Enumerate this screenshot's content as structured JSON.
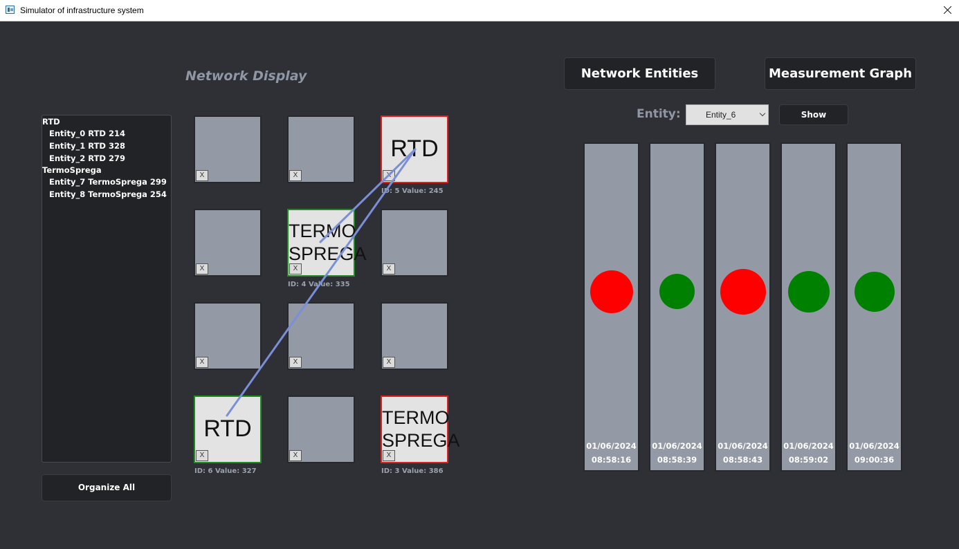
{
  "window": {
    "title": "Simulator of infrastructure system"
  },
  "heading": "Network Display",
  "tree": [
    {
      "group": "RTD",
      "items": [
        "Entity_0 RTD 214",
        "Entity_1 RTD 328",
        "Entity_2 RTD 279"
      ]
    },
    {
      "group": "TermoSprega",
      "items": [
        "Entity_7 TermoSprega 299",
        "Entity_8 TermoSprega 254"
      ]
    }
  ],
  "organize_label": "Organize All",
  "grid": [
    {
      "label": "",
      "info": "",
      "border": ""
    },
    {
      "label": "",
      "info": "",
      "border": ""
    },
    {
      "label": "RTD",
      "info": "ID: 5 Value: 245",
      "border": "red"
    },
    {
      "label": "",
      "info": "",
      "border": ""
    },
    {
      "label": "TERMO\nSPREGA",
      "info": "ID: 4 Value: 335",
      "border": "green"
    },
    {
      "label": "",
      "info": "",
      "border": ""
    },
    {
      "label": "",
      "info": "",
      "border": ""
    },
    {
      "label": "",
      "info": "",
      "border": ""
    },
    {
      "label": "",
      "info": "",
      "border": ""
    },
    {
      "label": "RTD",
      "info": "ID: 6 Value: 327",
      "border": "green"
    },
    {
      "label": "",
      "info": "",
      "border": ""
    },
    {
      "label": "TERMO\nSPREGA",
      "info": "ID: 3 Value: 386",
      "border": "red"
    }
  ],
  "cell_close_label": "X",
  "connections": [
    {
      "from": 9,
      "to": 2
    },
    {
      "from": 4,
      "to": 2
    }
  ],
  "buttons": {
    "network_entities": "Network Entities",
    "measurement_graph": "Measurement Graph",
    "show": "Show"
  },
  "entity_selector": {
    "label": "Entity:",
    "value": "Entity_6"
  },
  "measurements": [
    {
      "date": "01/06/2024",
      "time": "08:58:16",
      "status": "red",
      "level": 0.65
    },
    {
      "date": "01/06/2024",
      "time": "08:58:39",
      "status": "green",
      "level": 0.49
    },
    {
      "date": "01/06/2024",
      "time": "08:58:43",
      "status": "red",
      "level": 0.72
    },
    {
      "date": "01/06/2024",
      "time": "08:59:02",
      "status": "green",
      "level": 0.62
    },
    {
      "date": "01/06/2024",
      "time": "09:00:36",
      "status": "green",
      "level": 0.6
    }
  ],
  "colors": {
    "red": "#ff0000",
    "green": "#008000",
    "line": "#7b8fd8"
  }
}
